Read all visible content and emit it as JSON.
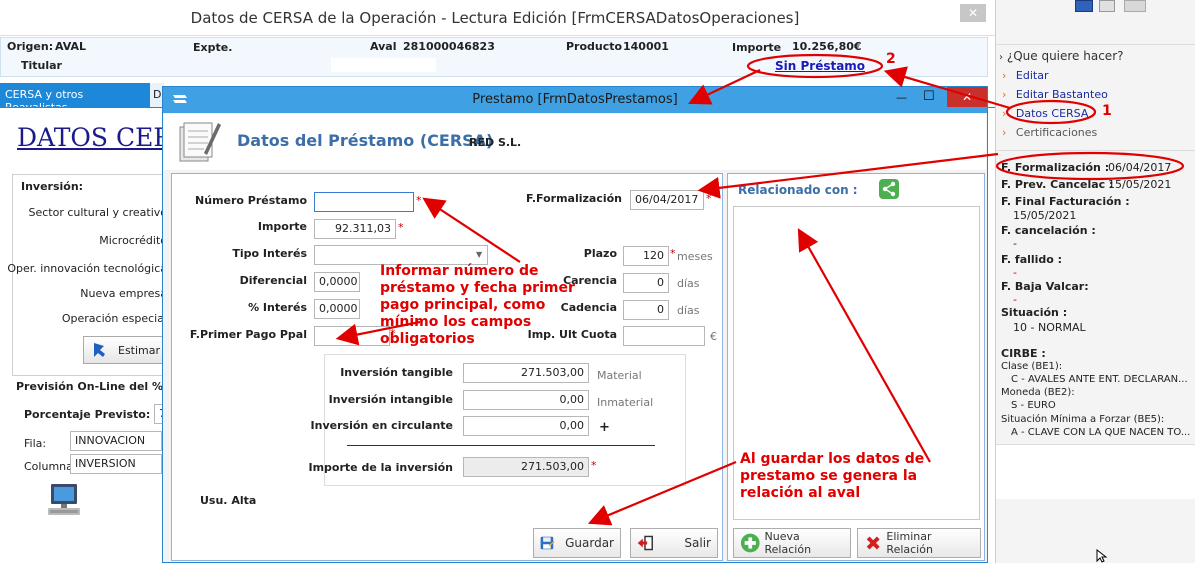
{
  "main_window": {
    "title": "Datos de CERSA de la Operación - Lectura Edición [FrmCERSADatosOperaciones]",
    "close_glyph": "✕",
    "header": {
      "origen_label": "Origen:",
      "origen_value": "AVAL",
      "expte_label": "Expte.",
      "aval_label": "Aval",
      "aval_value": "281000046823",
      "producto_label": "Producto",
      "producto_value": "140001",
      "importe_label": "Importe",
      "importe_value": "10.256,80€",
      "titular_label": "Titular",
      "sin_prestamo_link": "Sin Préstamo"
    },
    "tabs": [
      {
        "label": "CERSA y otros Reavalistas"
      },
      {
        "label": "D"
      }
    ],
    "left": {
      "heading": "DATOS CER",
      "inversion_label": "Inversión:",
      "rows": [
        "Sector cultural y creativo",
        "Microcrédito",
        "Oper. innovación tecnológica",
        "Nueva empresa",
        "Operación especial"
      ],
      "estimar_button": "Estimar C",
      "prevision_text": "Previsión On-Line del % d",
      "porcentaje_label": "Porcentaje Previsto:",
      "porcentaje_value": "7",
      "fila_label": "Fila:",
      "fila_value": "INNOVACION",
      "columna_label": "Columna:",
      "columna_value": "INVERSION"
    }
  },
  "right_panel": {
    "header": "¿Que quiere hacer?",
    "actions": [
      "Editar",
      "Editar Bastanteo",
      "Datos CERSA",
      "Certificaciones"
    ],
    "formalizacion_label": "F. Formalización :",
    "formalizacion_value": "06/04/2017",
    "prev_cancelac_label": "F. Prev. Cancelac :",
    "prev_cancelac_value": "15/05/2021",
    "final_facturacion_label": "F. Final Facturación :",
    "final_facturacion_value": "15/05/2021",
    "cancelacion_label": "F. cancelación :",
    "cancelacion_value": "-",
    "fallido_label": "F. fallido :",
    "fallido_value": "-",
    "baja_valcar_label": "F. Baja Valcar:",
    "baja_valcar_value": "-",
    "situacion_label": "Situación :",
    "situacion_value": "10 - NORMAL",
    "cirbe_label": "CIRBE :",
    "clase_label": "Clase (BE1):",
    "clase_value": "C - AVALES ANTE ENT. DECLARAN...",
    "moneda_label": "Moneda (BE2):",
    "moneda_value": "S - EURO",
    "situacion_min_label": "Situación Mínima a Forzar (BE5):",
    "situacion_min_value": "A - CLAVE CON LA QUE NACEN TO..."
  },
  "dialog": {
    "title": "Prestamo [FrmDatosPrestamos]",
    "heading": "Datos del Préstamo (CERSA)",
    "company": "RED S.L.",
    "min_glyph": "—",
    "max_glyph": "☐",
    "close_glyph": "✕",
    "fields": {
      "numero_prestamo_label": "Número Préstamo",
      "numero_prestamo_value": "",
      "importe_label": "Importe",
      "importe_value": "92.311,03",
      "tipo_interes_label": "Tipo Interés",
      "tipo_interes_value": "",
      "diferencial_label": "Diferencial",
      "diferencial_value": "0,0000",
      "pct_interes_label": "% Interés",
      "pct_interes_value": "0,0000",
      "primer_pago_label": "F.Primer Pago Ppal",
      "primer_pago_value": "",
      "usu_alta_label": "Usu. Alta",
      "formalizacion_label": "F.Formalización",
      "formalizacion_value": "06/04/2017",
      "plazo_label": "Plazo",
      "plazo_value": "120",
      "plazo_unit": "meses",
      "carencia_label": "Carencia",
      "carencia_value": "0",
      "carencia_unit": "días",
      "cadencia_label": "Cadencia",
      "cadencia_value": "0",
      "cadencia_unit": "días",
      "imp_ult_cuota_label": "Imp. Ult Cuota",
      "imp_ult_cuota_value": "",
      "imp_ult_cuota_unit": "€"
    },
    "inversion": {
      "tangible_label": "Inversión tangible",
      "tangible_value": "271.503,00",
      "tangible_unit": "Material",
      "intangible_label": "Inversión intangible",
      "intangible_value": "0,00",
      "intangible_unit": "Inmaterial",
      "circulante_label": "Inversión en circulante",
      "circulante_value": "0,00",
      "plus": "+",
      "total_label": "Importe de la inversión",
      "total_value": "271.503,00"
    },
    "relacionado_label": "Relacionado con :",
    "buttons": {
      "guardar": "Guardar",
      "salir": "Salir",
      "nueva_relacion": "Nueva Relación",
      "eliminar_relacion": "Eliminar Relación"
    }
  },
  "annotations": {
    "num1": "1",
    "num2": "2",
    "informar_lines": [
      "Informar número de",
      "préstamo y fecha primer",
      "pago principal, como",
      "mínimo los campos",
      "obligatorios"
    ],
    "guardar_lines": [
      "Al guardar los datos de",
      "prestamo se genera la",
      "relación al aval"
    ]
  },
  "colors": {
    "annotation_red": "#e00000",
    "dialog_title_bg": "#3fa1e3",
    "tab_active_bg": "#1e88d8",
    "link_blue": "#1a1ab8",
    "heading_blue": "#3c6ea8"
  }
}
